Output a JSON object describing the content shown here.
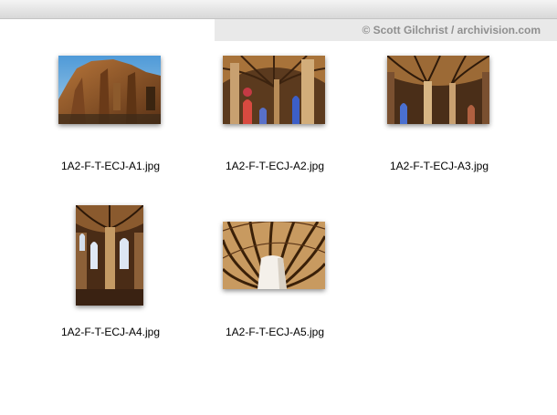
{
  "window": {
    "credit_text": "© Scott Gilchrist / archivision.com"
  },
  "files": [
    {
      "name": "1A2-F-T-ECJ-A1.jpg",
      "thumbnail": "cathedral-exterior-apse"
    },
    {
      "name": "1A2-F-T-ECJ-A2.jpg",
      "thumbnail": "vaulted-nave-with-windows"
    },
    {
      "name": "1A2-F-T-ECJ-A3.jpg",
      "thumbnail": "ribbed-vault-columns"
    },
    {
      "name": "1A2-F-T-ECJ-A4.jpg",
      "thumbnail": "nave-interior-vertical"
    },
    {
      "name": "1A2-F-T-ECJ-A5.jpg",
      "thumbnail": "palm-tree-vault"
    }
  ]
}
